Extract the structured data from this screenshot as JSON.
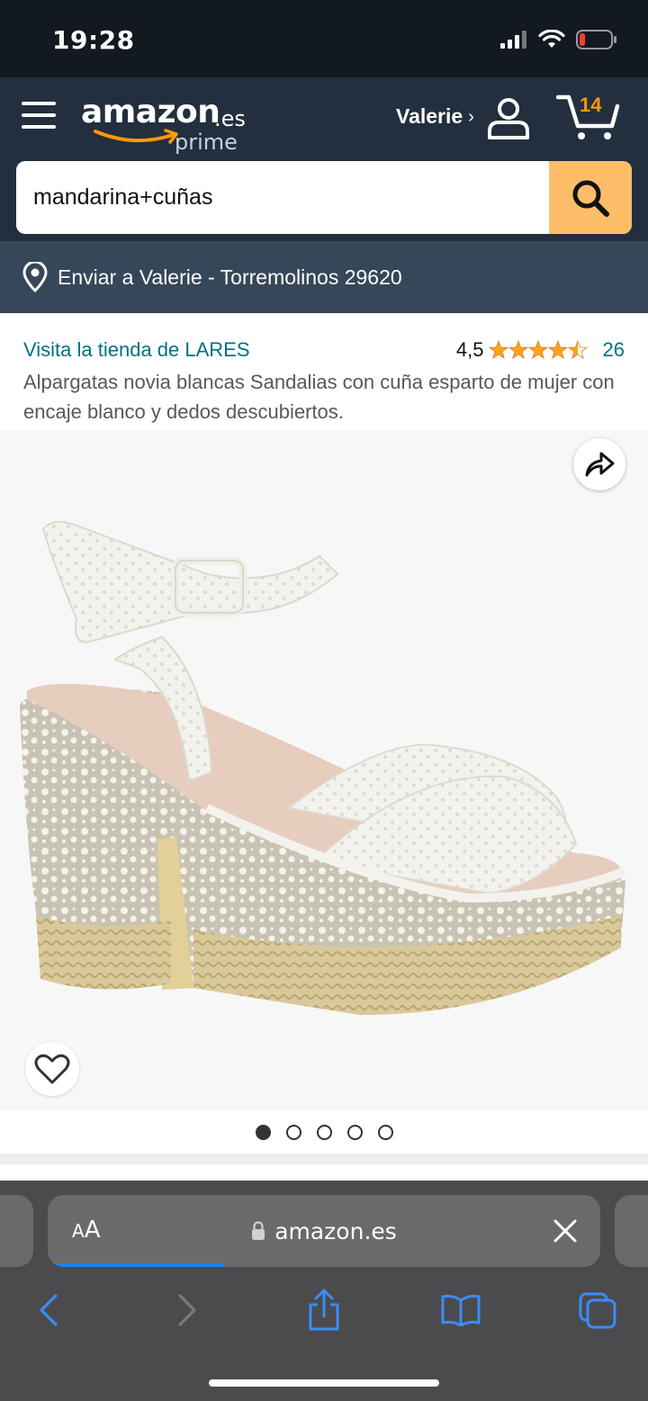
{
  "status_bar": {
    "time": "19:28",
    "icons": [
      "signal-icon",
      "wifi-icon",
      "battery-low-icon"
    ]
  },
  "header": {
    "logo_word": "amazon",
    "logo_tld": ".es",
    "logo_prime": "prime",
    "account_name": "Valerie",
    "account_chevron": "›",
    "cart_count": "14",
    "icons": [
      "menu-icon",
      "user-icon",
      "cart-icon"
    ]
  },
  "search": {
    "value": "mandarina+cuñas",
    "button_icon": "search-icon"
  },
  "delivery": {
    "text": "Enviar a Valerie - Torremolinos 29620",
    "icon": "location-pin-icon"
  },
  "product": {
    "store_link": "Visita la tienda de LARES",
    "rating_value": "4,5",
    "rating_stars": 4.5,
    "rating_count": "26",
    "title": "Alpargatas novia blancas Sandalias con cuña esparto de mujer con encaje blanco y dedos descubiertos.",
    "image_name": "white-lace-wedge-espadrille-sandal",
    "image_count": 5,
    "active_image": 0
  },
  "browser": {
    "aa_small": "A",
    "aa_big": "A",
    "url": "amazon.es",
    "load_progress": 0.32,
    "toolbar": [
      "back-icon",
      "forward-icon",
      "share-icon",
      "bookmarks-icon",
      "tabs-icon"
    ]
  },
  "colors": {
    "header_bg": "#232f3e",
    "status_bg": "#131921",
    "delivery_bg": "#37475a",
    "search_button": "#febd69",
    "link": "#007185",
    "star": "#ffa41c",
    "cart_badge": "#ff9900",
    "safari_bg": "#4b4b4d",
    "safari_accent": "#1a82fb"
  }
}
